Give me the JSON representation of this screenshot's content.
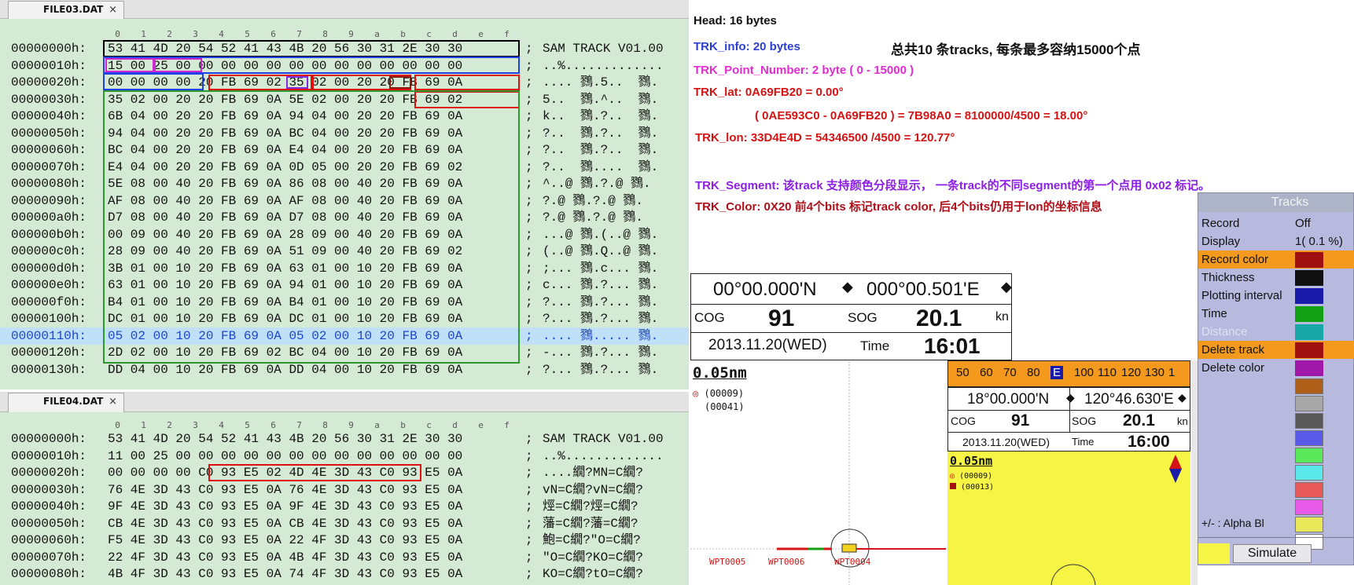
{
  "file1": {
    "tab": "FILE03.DAT",
    "close": "×",
    "ruler": [
      "0",
      "1",
      "2",
      "3",
      "4",
      "5",
      "6",
      "7",
      "8",
      "9",
      "a",
      "b",
      "c",
      "d",
      "e",
      "f"
    ],
    "rows": [
      {
        "addr": "00000000h:",
        "bytes": "53 41 4D 20 54 52 41 43 4B 20 56 30 31 2E 30 30",
        "sep": ";",
        "ascii": "SAM TRACK V01.00"
      },
      {
        "addr": "00000010h:",
        "bytes": "15 00 25 00 00 00 00 00 00 00 00 00 00 00 00 00",
        "sep": ";",
        "ascii": "..%............."
      },
      {
        "addr": "00000020h:",
        "bytes": "00 00 00 00 20 FB 69 02 35 02 00 20 20 FB 69 0A",
        "sep": ";",
        "ascii": ".... 鷚.5..  鷚."
      },
      {
        "addr": "00000030h:",
        "bytes": "35 02 00 20 20 FB 69 0A 5E 02 00 20 20 FB 69 02",
        "sep": ";",
        "ascii": "5..  鷚.^..  鷚."
      },
      {
        "addr": "00000040h:",
        "bytes": "6B 04 00 20 20 FB 69 0A 94 04 00 20 20 FB 69 0A",
        "sep": ";",
        "ascii": "k..  鷚.?..  鷚."
      },
      {
        "addr": "00000050h:",
        "bytes": "94 04 00 20 20 FB 69 0A BC 04 00 20 20 FB 69 0A",
        "sep": ";",
        "ascii": "?..  鷚.?..  鷚."
      },
      {
        "addr": "00000060h:",
        "bytes": "BC 04 00 20 20 FB 69 0A E4 04 00 20 20 FB 69 0A",
        "sep": ";",
        "ascii": "?..  鷚.?..  鷚."
      },
      {
        "addr": "00000070h:",
        "bytes": "E4 04 00 20 20 FB 69 0A 0D 05 00 20 20 FB 69 02",
        "sep": ";",
        "ascii": "?..  鷚....  鷚."
      },
      {
        "addr": "00000080h:",
        "bytes": "5E 08 00 40 20 FB 69 0A 86 08 00 40 20 FB 69 0A",
        "sep": ";",
        "ascii": "^..@ 鷚.?.@ 鷚."
      },
      {
        "addr": "00000090h:",
        "bytes": "AF 08 00 40 20 FB 69 0A AF 08 00 40 20 FB 69 0A",
        "sep": ";",
        "ascii": "?.@ 鷚.?.@ 鷚."
      },
      {
        "addr": "000000a0h:",
        "bytes": "D7 08 00 40 20 FB 69 0A D7 08 00 40 20 FB 69 0A",
        "sep": ";",
        "ascii": "?.@ 鷚.?.@ 鷚."
      },
      {
        "addr": "000000b0h:",
        "bytes": "00 09 00 40 20 FB 69 0A 28 09 00 40 20 FB 69 0A",
        "sep": ";",
        "ascii": "...@ 鷚.(..@ 鷚."
      },
      {
        "addr": "000000c0h:",
        "bytes": "28 09 00 40 20 FB 69 0A 51 09 00 40 20 FB 69 02",
        "sep": ";",
        "ascii": "(..@ 鷚.Q..@ 鷚."
      },
      {
        "addr": "000000d0h:",
        "bytes": "3B 01 00 10 20 FB 69 0A 63 01 00 10 20 FB 69 0A",
        "sep": ";",
        "ascii": ";... 鷚.c... 鷚."
      },
      {
        "addr": "000000e0h:",
        "bytes": "63 01 00 10 20 FB 69 0A 94 01 00 10 20 FB 69 0A",
        "sep": ";",
        "ascii": "c... 鷚.?... 鷚."
      },
      {
        "addr": "000000f0h:",
        "bytes": "B4 01 00 10 20 FB 69 0A B4 01 00 10 20 FB 69 0A",
        "sep": ";",
        "ascii": "?... 鷚.?... 鷚."
      },
      {
        "addr": "00000100h:",
        "bytes": "DC 01 00 10 20 FB 69 0A DC 01 00 10 20 FB 69 0A",
        "sep": ";",
        "ascii": "?... 鷚.?... 鷚."
      },
      {
        "addr": "00000110h:",
        "bytes": "05 02 00 10 20 FB 69 0A 05 02 00 10 20 FB 69 0A",
        "sep": ";",
        "ascii": ".... 鷚..... 鷚."
      },
      {
        "addr": "00000120h:",
        "bytes": "2D 02 00 10 20 FB 69 02 BC 04 00 10 20 FB 69 0A",
        "sep": ";",
        "ascii": "-... 鷚.?... 鷚."
      },
      {
        "addr": "00000130h:",
        "bytes": "DD 04 00 10 20 FB 69 0A DD 04 00 10 20 FB 69 0A",
        "sep": ";",
        "ascii": "?... 鷚.?... 鷚."
      }
    ]
  },
  "file2": {
    "tab": "FILE04.DAT",
    "close": "×",
    "ruler": [
      "0",
      "1",
      "2",
      "3",
      "4",
      "5",
      "6",
      "7",
      "8",
      "9",
      "a",
      "b",
      "c",
      "d",
      "e",
      "f"
    ],
    "rows": [
      {
        "addr": "00000000h:",
        "bytes": "53 41 4D 20 54 52 41 43 4B 20 56 30 31 2E 30 30",
        "sep": ";",
        "ascii": "SAM TRACK V01.00"
      },
      {
        "addr": "00000010h:",
        "bytes": "11 00 25 00 00 00 00 00 00 00 00 00 00 00 00 00",
        "sep": ";",
        "ascii": "..%............."
      },
      {
        "addr": "00000020h:",
        "bytes": "00 00 00 00 C0 93 E5 02 4D 4E 3D 43 C0 93 E5 0A",
        "sep": ";",
        "ascii": "....繝?MN=C繝?"
      },
      {
        "addr": "00000030h:",
        "bytes": "76 4E 3D 43 C0 93 E5 0A 76 4E 3D 43 C0 93 E5 0A",
        "sep": ";",
        "ascii": "vN=C繝?vN=C繝?"
      },
      {
        "addr": "00000040h:",
        "bytes": "9F 4E 3D 43 C0 93 E5 0A 9F 4E 3D 43 C0 93 E5 0A",
        "sep": ";",
        "ascii": "烴=C繝?烴=C繝?"
      },
      {
        "addr": "00000050h:",
        "bytes": "CB 4E 3D 43 C0 93 E5 0A CB 4E 3D 43 C0 93 E5 0A",
        "sep": ";",
        "ascii": "藩=C繝?藩=C繝?"
      },
      {
        "addr": "00000060h:",
        "bytes": "F5 4E 3D 43 C0 93 E5 0A 22 4F 3D 43 C0 93 E5 0A",
        "sep": ";",
        "ascii": "鮑=C繝?\"O=C繝?"
      },
      {
        "addr": "00000070h:",
        "bytes": "22 4F 3D 43 C0 93 E5 0A 4B 4F 3D 43 C0 93 E5 0A",
        "sep": ";",
        "ascii": "\"O=C繝?KO=C繝?"
      },
      {
        "addr": "00000080h:",
        "bytes": "4B 4F 3D 43 C0 93 E5 0A 74 4F 3D 43 C0 93 E5 0A",
        "sep": ";",
        "ascii": "KO=C繝?tO=C繝?"
      }
    ]
  },
  "annotations": {
    "head": "Head:  16 bytes",
    "summary": "总共10 条tracks, 每条最多容纳15000个点",
    "trk_info": "TRK_info: 20 bytes",
    "trk_point_number": "TRK_Point_Number: 2 byte ( 0 - 15000 )",
    "trk_lat": "TRK_lat:  0A69FB20 = 0.00°",
    "trk_lat_calc": "( 0AE593C0 - 0A69FB20 ) = 7B98A0 = 8100000/4500 = 18.00°",
    "trk_lon": "TRK_lon: 33D4E4D = 54346500 /4500 = 120.77°",
    "trk_segment": "TRK_Segment:  该track 支持颜色分段显示， 一条track的不同segment的第一个点用 0x02 标记。",
    "trk_color": "TRK_Color: 0X20 前4个bits 标记track color, 后4个bits仍用于lon的坐标信息"
  },
  "colors": {
    "annot_black": "#111111",
    "annot_blue": "#2b3fd0",
    "annot_magenta": "#e22bd0",
    "annot_red": "#d41414",
    "annot_purple": "#8c1ee6",
    "annot_darkred": "#b0101a",
    "hex_bg": "#d5ead5",
    "box_black": "#000000",
    "box_blue": "#2040e8",
    "box_magenta": "#d028d0",
    "box_red": "#e01010",
    "box_green": "#2e9a2e",
    "menu_bg": "#b7b9de",
    "menu_highlight": "#f39a1e",
    "map_yellow": "#f6f545"
  },
  "tracks_menu": {
    "title": "Tracks",
    "items": [
      {
        "label": "Record",
        "value": "Off",
        "swatch": "",
        "highlight": false,
        "dim": false
      },
      {
        "label": "Display",
        "value": "1(   0.1 %)",
        "swatch": "",
        "highlight": false,
        "dim": false
      },
      {
        "label": "Record color",
        "value": "",
        "swatch": "#a01010",
        "highlight": true,
        "dim": false
      },
      {
        "label": "Thickness",
        "value": "",
        "swatch": "#101010",
        "highlight": false,
        "dim": false
      },
      {
        "label": "Plotting interval",
        "value": "",
        "swatch": "#1a1aa8",
        "highlight": false,
        "dim": false
      },
      {
        "label": "Time",
        "value": "",
        "swatch": "#14a014",
        "highlight": false,
        "dim": false
      },
      {
        "label": "Distance",
        "value": "",
        "swatch": "#18a8a8",
        "highlight": false,
        "dim": true
      },
      {
        "label": "Delete track",
        "value": "",
        "swatch": "#a01010",
        "highlight": true,
        "dim": false
      },
      {
        "label": "Delete color",
        "value": "",
        "swatch": "#a018a8",
        "highlight": false,
        "dim": false
      }
    ],
    "extra_swatches": [
      "#b06018",
      "#a8a8a8",
      "#585858",
      "#5a5ae8",
      "#5ae85a",
      "#5ae8e8",
      "#e85a5a",
      "#e85ae8",
      "#e8e85a",
      "#ffffff"
    ],
    "alpha_label": "+/- :    Alpha Bl",
    "simulate": "Simulate"
  },
  "plotter1": {
    "lat": "00°00.000'N",
    "lon": "000°00.501'E",
    "cog_label": "COG",
    "cog": "91",
    "sog_label": "SOG",
    "sog": "20.1",
    "sog_unit": "kn",
    "date": "2013.11.20(WED)",
    "time_label": "Time",
    "time": "16:01",
    "scale": "0.05nm",
    "legend1": "(00009)",
    "legend2": "(00041)",
    "wpts": [
      "WPT0005",
      "WPT0006",
      "WPT0004"
    ]
  },
  "plotter2": {
    "compass": [
      "50",
      "60",
      "70",
      "80",
      "E",
      "100",
      "110",
      "120",
      "130",
      "1"
    ],
    "lat": "18°00.000'N",
    "lon": "120°46.630'E",
    "cog_label": "COG",
    "cog": "91",
    "sog_label": "SOG",
    "sog": "20.1",
    "sog_unit": "kn",
    "date": "2013.11.20(WED)",
    "time_label": "Time",
    "time": "16:00",
    "scale": "0.05nm",
    "legend1": "(00009)",
    "legend2": "(00013)"
  }
}
